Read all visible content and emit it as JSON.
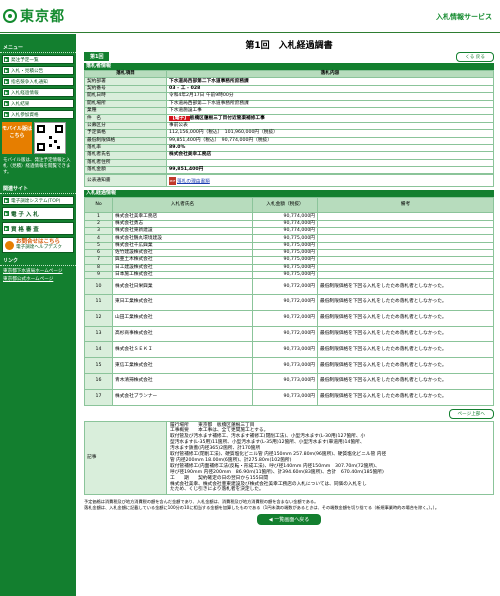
{
  "header": {
    "logo_text": "東京都",
    "site_title": "入札情報サービス"
  },
  "sidebar": {
    "menu_heading": "メニュー",
    "menu_items": [
      "発注予定一覧",
      "入札・見積公告",
      "指名競争入札通知",
      "入札経過情報",
      "入札結果",
      "入札参加資格"
    ],
    "mobile_badge": "モバイル版はこちら",
    "mobile_note": "モバイル版は、発注予定情報と入札（見積）経過情報を閲覧できます。",
    "related_heading": "関連サイト",
    "related_items": [
      "電子調達システム(TOP)",
      "電 子 入 札",
      "資 格 審 査"
    ],
    "contact_title": "お問合せはこちら",
    "contact_sub": "電子調達ヘルプデスク",
    "links_heading": "リンク",
    "links": [
      "東京都下水道局ホームページ",
      "東京都公式ホームページ"
    ]
  },
  "main": {
    "page_title": "第1回　入札経過調書",
    "round_badge": "第1回",
    "back_top_label": "くる 戻る",
    "info_heading": "落札者情報",
    "info_header": [
      "落札項目",
      "落札内容"
    ],
    "info_rows": [
      {
        "label": "契約部署",
        "value": "下水道局西部第二下水道事務所庶務課",
        "bold": true
      },
      {
        "label": "契約番号",
        "value": "03 - 工 - 028",
        "bold": true
      },
      {
        "label": "開札日時",
        "value": "令和4年2月17日 午前9時00分"
      },
      {
        "label": "開札場所",
        "value": "下水道局西部第二下水道事務所庶務課"
      },
      {
        "label": "業種",
        "value": "下水道施設工事"
      },
      {
        "label": "件　名",
        "tag": "【電子】",
        "value": "板橋区蓮根三丁目付近管渠補修工事",
        "bold": true
      },
      {
        "label": "公募区分",
        "value": "事前公表"
      },
      {
        "label": "予定価格",
        "value": "112,156,000円（税込）　101,960,000円（税抜）"
      },
      {
        "label": "最低制限価格",
        "value": "99,851,400円（税込）　90,774,000円（税抜）"
      },
      {
        "label": "落札率",
        "value": "89.0%",
        "bold": true
      },
      {
        "label": "落札者氏名",
        "value": "株式会社美幸工務店",
        "bold": true
      },
      {
        "label": "落札者住所",
        "value": ""
      },
      {
        "label": "落札金額",
        "value": "99,851,400円",
        "bold": true
      }
    ],
    "notice_label": "公表通知書",
    "notice_link": "落札の理由書類",
    "bids_heading": "入札経過情報",
    "bids_headers": {
      "no": "No",
      "name": "入札者氏名",
      "amount": "入札金額（税抜）",
      "remarks": "備考"
    },
    "bids": [
      {
        "no": "1",
        "name": "株式会社美幸工務店",
        "amount": "90,774,000円",
        "remarks": ""
      },
      {
        "no": "2",
        "name": "株式会社勇志",
        "amount": "90,774,000円",
        "remarks": ""
      },
      {
        "no": "3",
        "name": "株式会社東新建設",
        "amount": "90,774,000円",
        "remarks": ""
      },
      {
        "no": "4",
        "name": "株式会社鶴丸環境建設",
        "amount": "90,775,000円",
        "remarks": ""
      },
      {
        "no": "5",
        "name": "株式会社千広興業",
        "amount": "90,775,000円",
        "remarks": ""
      },
      {
        "no": "6",
        "name": "佐竹建設株式会社",
        "amount": "90,775,000円",
        "remarks": ""
      },
      {
        "no": "7",
        "name": "興亜土木株式会社",
        "amount": "90,775,000円",
        "remarks": ""
      },
      {
        "no": "8",
        "name": "日工建設株式会社",
        "amount": "90,775,000円",
        "remarks": ""
      },
      {
        "no": "9",
        "name": "日本施工株式会社",
        "amount": "90,775,000円",
        "remarks": ""
      },
      {
        "no": "10",
        "name": "株式会社日栄興業",
        "amount": "90,772,000円",
        "remarks": "最低制限価格を下回る入札をしたため落札者としなかった。"
      },
      {
        "no": "11",
        "name": "東日工業株式会社",
        "amount": "90,772,000円",
        "remarks": "最低制限価格を下回る入札をしたため落札者としなかった。"
      },
      {
        "no": "12",
        "name": "山田工業株式会社",
        "amount": "90,772,000円",
        "remarks": "最低制限価格を下回る入札をしたため落札者としなかった。"
      },
      {
        "no": "13",
        "name": "高杉商事株式会社",
        "amount": "90,772,000円",
        "remarks": "最低制限価格を下回る入札をしたため落札者としなかった。"
      },
      {
        "no": "14",
        "name": "株式会社ＳＥＫＩ",
        "amount": "90,773,000円",
        "remarks": "最低制限価格を下回る入札をしたため落札者としなかった。"
      },
      {
        "no": "15",
        "name": "東信工業株式会社",
        "amount": "90,773,000円",
        "remarks": "最低制限価格を下回る入札をしたため落札者としなかった。"
      },
      {
        "no": "16",
        "name": "青木清掃株式会社",
        "amount": "90,773,000円",
        "remarks": "最低制限価格を下回る入札をしたため落札者としなかった。"
      },
      {
        "no": "17",
        "name": "株式会社ブランナー",
        "amount": "90,773,000円",
        "remarks": "最低制限価格を下回る入札をしたため落札者としなかった。"
      }
    ],
    "page_top_label": "ページ上部へ",
    "remarks_label": "記事",
    "remarks_lines": [
      "履行場所　　東京都　板橋区蓮根三丁目",
      "工事概要　　本工事は、全て更間施工とする。",
      "取付管及び汚水ます補修工、汚水ます補修工(閉削工法)、小型汚水ます(L-30用)127箇所、小",
      "型汚水ます(L-35用)11箇所、小型汚水ます(L-35用)12箇所、小型汚水ます(車道用)14箇所、",
      "汚水ます鉄蓋(内径365)2箇所、計170箇所",
      "取付管補修工(閉削工法)、硬質塩化ビニル管 内径150mm 257.80m(96箇所)、硬質塩化ビニル管 内径",
      "管 内径200mm 18.00m(6箇所)、計275.80m(102箇所)",
      "取付管補修工(内面補修工法(反転・形成工法)、呼び径140mm 内径150mm　307.70m(72箇所)、",
      "呼び径190mm 内径200mm　86.90m(11箇所)、計394.60m(83箇所)、合計　670.40m(185箇所)",
      "工　　期　　契約確定の日の翌日から155日間",
      "株式会社美幸、株式会社豊東建設及び株式会社美幸工務店の入札については、同価の入札をし",
      "たため、くじ引きにより落札者を決定した。"
    ],
    "footnotes": [
      "予定価格は消費税及び地方消費税の額を含んだ金額であり、入札金額は、消費税及び地方消費税の額を含まない金額である。",
      "落札金額は、入札金額に記載している金額に100分の10に相当する金額を加算したものである（1円未満の端数があるときは、その端数金額を切り捨てる（新規事業時的の場合を除く。）。）。"
    ],
    "back_list_label": "一覧画面へ戻る"
  }
}
